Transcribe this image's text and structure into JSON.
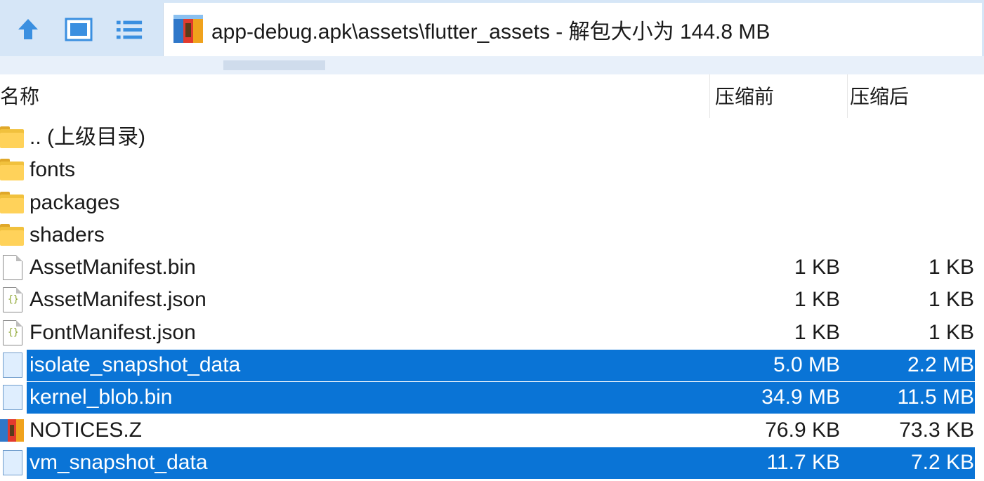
{
  "toolbar": {
    "buttons": [
      {
        "icon": "up-arrow-icon",
        "label": ""
      },
      {
        "icon": "single-pane-icon",
        "label": ""
      },
      {
        "icon": "list-view-icon",
        "label": ""
      }
    ],
    "path": "app-debug.apk\\assets\\flutter_assets - 解包大小为 144.8 MB"
  },
  "columns": {
    "name": "名称",
    "before": "压缩前",
    "after": "压缩后"
  },
  "rows": [
    {
      "name": ".. (上级目录)",
      "type": "folder-up",
      "before": "",
      "after": "",
      "selected": false
    },
    {
      "name": "fonts",
      "type": "folder",
      "before": "",
      "after": "",
      "selected": false
    },
    {
      "name": "packages",
      "type": "folder",
      "before": "",
      "after": "",
      "selected": false
    },
    {
      "name": "shaders",
      "type": "folder",
      "before": "",
      "after": "",
      "selected": false
    },
    {
      "name": "AssetManifest.bin",
      "type": "file",
      "before": "1 KB",
      "after": "1 KB",
      "selected": false
    },
    {
      "name": "AssetManifest.json",
      "type": "json",
      "before": "1 KB",
      "after": "1 KB",
      "selected": false
    },
    {
      "name": "FontManifest.json",
      "type": "json",
      "before": "1 KB",
      "after": "1 KB",
      "selected": false
    },
    {
      "name": "isolate_snapshot_data",
      "type": "bluefile",
      "before": "5.0 MB",
      "after": "2.2 MB",
      "selected": true
    },
    {
      "name": "kernel_blob.bin",
      "type": "bluefile",
      "before": "34.9 MB",
      "after": "11.5 MB",
      "selected": true
    },
    {
      "name": "NOTICES.Z",
      "type": "archive",
      "before": "76.9 KB",
      "after": "73.3 KB",
      "selected": false
    },
    {
      "name": "vm_snapshot_data",
      "type": "bluefile",
      "before": "11.7 KB",
      "after": "7.2 KB",
      "selected": true
    }
  ],
  "colors": {
    "selection": "#0a74d6",
    "toolbar": "#d6e6f7",
    "folder": "#ffd25a"
  }
}
